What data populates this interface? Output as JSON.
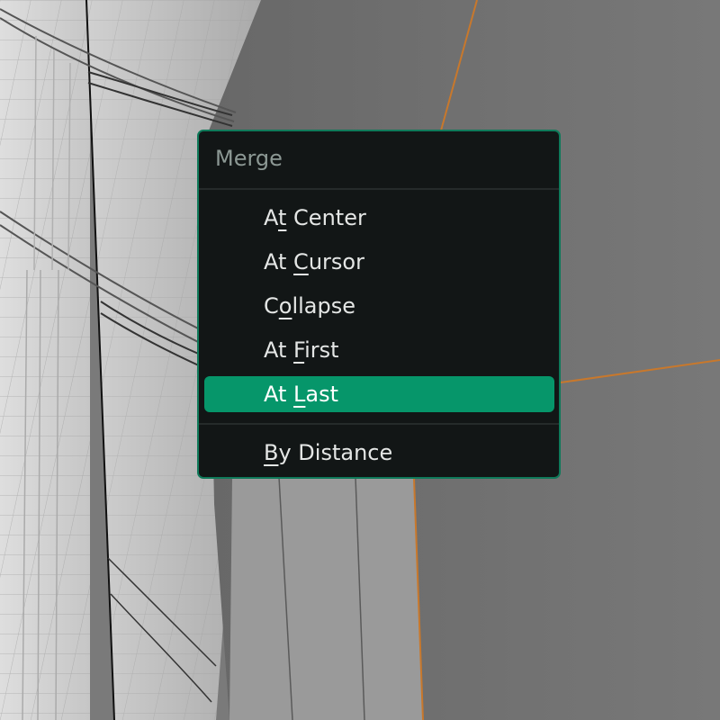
{
  "viewport": {
    "background": "3d-viewport-edit-mode",
    "edge_color": "#c8782c",
    "face_color": "#707070"
  },
  "menu": {
    "title": "Merge",
    "border_color": "#0f7a5a",
    "highlight_color": "#06966a",
    "items": [
      {
        "pre": "A",
        "key": "t",
        "post": " Center",
        "selected": false
      },
      {
        "pre": "At ",
        "key": "C",
        "post": "ursor",
        "selected": false
      },
      {
        "pre": "C",
        "key": "o",
        "post": "llapse",
        "selected": false
      },
      {
        "pre": "At ",
        "key": "F",
        "post": "irst",
        "selected": false
      },
      {
        "pre": "At ",
        "key": "L",
        "post": "ast",
        "selected": true
      },
      {
        "pre": "",
        "key": "B",
        "post": "y Distance",
        "selected": false
      }
    ]
  }
}
